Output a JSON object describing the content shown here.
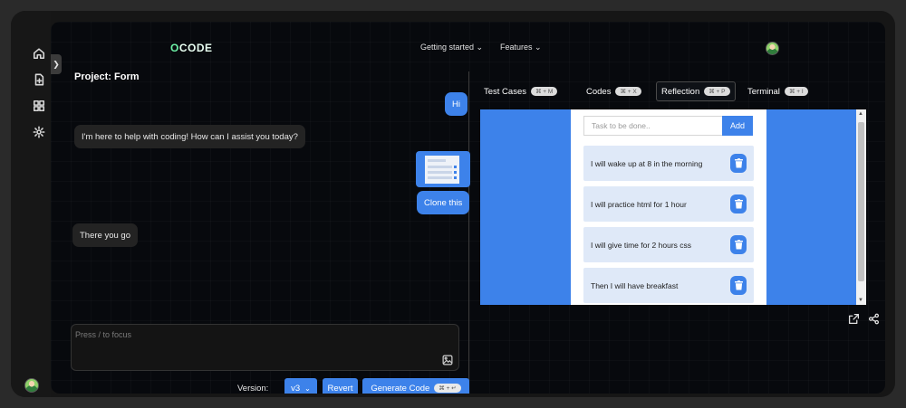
{
  "rail": {
    "icons": [
      "home-icon",
      "new-file-icon",
      "apps-icon",
      "settings-icon"
    ]
  },
  "header": {
    "logo_o": "O",
    "logo_rest": "CODE",
    "nav": [
      {
        "label": "Getting started ⌄"
      },
      {
        "label": "Features ⌄"
      }
    ]
  },
  "project": {
    "title": "Project: Form"
  },
  "chat": {
    "messages": [
      {
        "role": "user",
        "text": "Hi"
      },
      {
        "role": "bot",
        "text": "I'm here to help with coding! How can I assist you today?"
      },
      {
        "role": "user",
        "text": "Clone this"
      },
      {
        "role": "bot",
        "text": "There you go"
      }
    ]
  },
  "prompt": {
    "placeholder": "Press / to focus"
  },
  "footer": {
    "version_label": "Version:",
    "version_value": "v3",
    "revert_label": "Revert",
    "generate_label": "Generate Code",
    "generate_kbd": "⌘ + ↵"
  },
  "tabs": [
    {
      "label": "Test Cases",
      "kbd": "⌘ + M"
    },
    {
      "label": "Codes",
      "kbd": "⌘ + X"
    },
    {
      "label": "Reflection",
      "kbd": "⌘ + P",
      "active": true
    },
    {
      "label": "Terminal",
      "kbd": "⌘ + I"
    }
  ],
  "preview": {
    "input_placeholder": "Task to be done..",
    "add_label": "Add",
    "items": [
      "I will wake up at 8 in the morning",
      "I will practice html for 1 hour",
      "I will give time for 2 hours css",
      "Then I will have breakfast"
    ],
    "scroll_up": "▲",
    "scroll_down": "▼"
  },
  "colors": {
    "accent": "#3d82ea",
    "logo_accent": "#6df0a6",
    "background": "#07090d"
  }
}
